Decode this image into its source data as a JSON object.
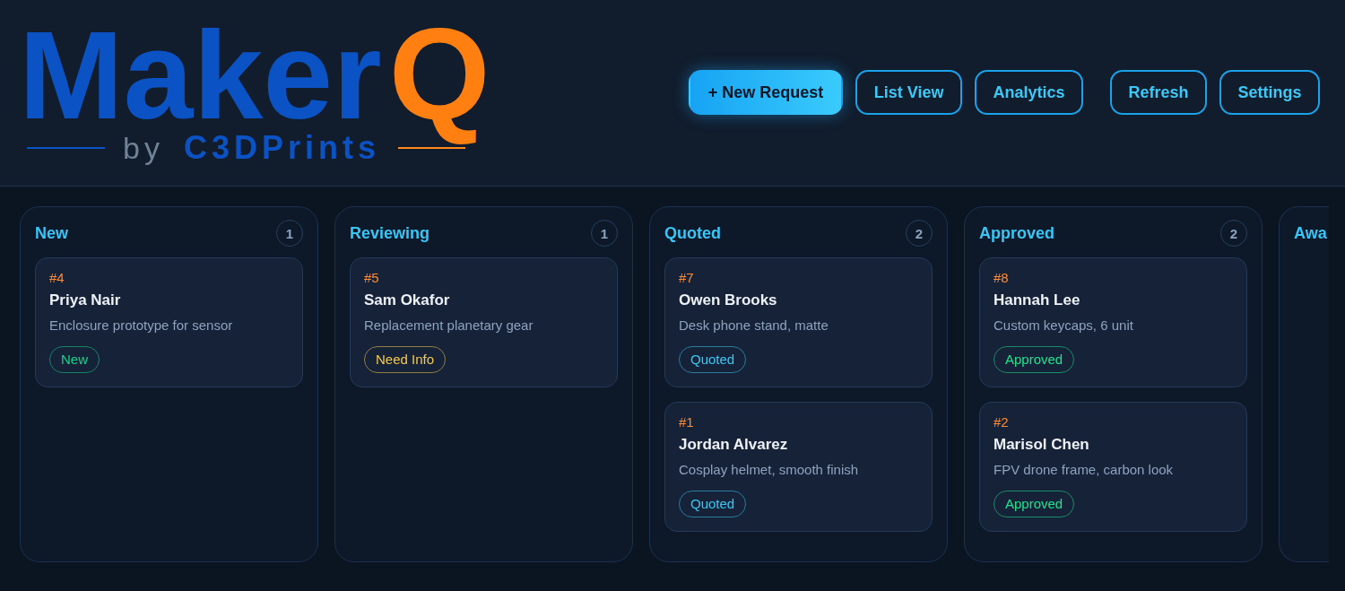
{
  "header": {
    "logo": {
      "wordmark": "Maker",
      "letter": "Q",
      "byline": "by",
      "brand": "C3DPrints"
    },
    "actions": [
      {
        "label": "+ New Request",
        "kind": "primary"
      },
      {
        "label": "List View",
        "kind": "outline"
      },
      {
        "label": "Analytics",
        "kind": "outline"
      }
    ],
    "utility_actions": [
      {
        "label": "Refresh",
        "kind": "outline"
      },
      {
        "label": "Settings",
        "kind": "outline"
      }
    ]
  },
  "board": {
    "columns": [
      {
        "title": "New",
        "count": "1",
        "cards": [
          {
            "number": "#4",
            "customer": "Priya Nair",
            "description": "Enclosure prototype for sensor",
            "tag": {
              "label": "New",
              "color": "#14d48d"
            }
          }
        ]
      },
      {
        "title": "Reviewing",
        "count": "1",
        "cards": [
          {
            "number": "#5",
            "customer": "Sam Okafor",
            "description": "Replacement planetary gear",
            "tag": {
              "label": "Need Info",
              "color": "#f7c948"
            }
          }
        ]
      },
      {
        "title": "Quoted",
        "count": "2",
        "cards": [
          {
            "number": "#7",
            "customer": "Owen Brooks",
            "description": "Desk phone stand, matte",
            "tag": {
              "label": "Quoted",
              "color": "#38c8f5"
            }
          },
          {
            "number": "#1",
            "customer": "Jordan Alvarez",
            "description": "Cosplay helmet, smooth finish",
            "tag": {
              "label": "Quoted",
              "color": "#38c8f5"
            }
          }
        ]
      },
      {
        "title": "Approved",
        "count": "2",
        "cards": [
          {
            "number": "#8",
            "customer": "Hannah Lee",
            "description": "Custom keycaps, 6 unit",
            "tag": {
              "label": "Approved",
              "color": "#1de38f"
            }
          },
          {
            "number": "#2",
            "customer": "Marisol Chen",
            "description": "FPV drone frame, carbon look",
            "tag": {
              "label": "Approved",
              "color": "#1de38f"
            }
          }
        ]
      },
      {
        "title": "Awa"
      }
    ]
  }
}
